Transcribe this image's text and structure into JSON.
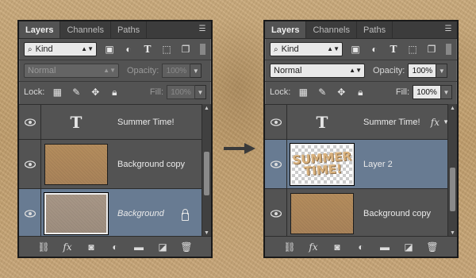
{
  "panels": [
    {
      "tabs": [
        "Layers",
        "Channels",
        "Paths"
      ],
      "filter": "Kind",
      "blend_mode": "Normal",
      "opacity_label": "Opacity:",
      "opacity": "100%",
      "lock_label": "Lock:",
      "fill_label": "Fill:",
      "fill": "100%",
      "layers": [
        {
          "name": "Summer Time!",
          "kind": "text"
        },
        {
          "name": "Background copy",
          "kind": "image"
        },
        {
          "name": "Background",
          "kind": "image",
          "selected": true,
          "locked": true
        }
      ]
    },
    {
      "tabs": [
        "Layers",
        "Channels",
        "Paths"
      ],
      "filter": "Kind",
      "blend_mode": "Normal",
      "opacity_label": "Opacity:",
      "opacity": "100%",
      "lock_label": "Lock:",
      "fill_label": "Fill:",
      "fill": "100%",
      "layers": [
        {
          "name": "Summer Time!",
          "kind": "text",
          "fx": "fx"
        },
        {
          "name": "Layer 2",
          "kind": "image",
          "selected": true,
          "thumb_text": "SUMMER TIME!"
        },
        {
          "name": "Background copy",
          "kind": "image"
        }
      ]
    }
  ],
  "icons": {
    "text_layer": "T",
    "fx": "fx",
    "panel_menu": "menu-icon",
    "arrow": "right-arrow-icon"
  },
  "colors": {
    "panel_bg": "#535353",
    "selected_row": "#687b92",
    "sand": "#c2a06e"
  }
}
